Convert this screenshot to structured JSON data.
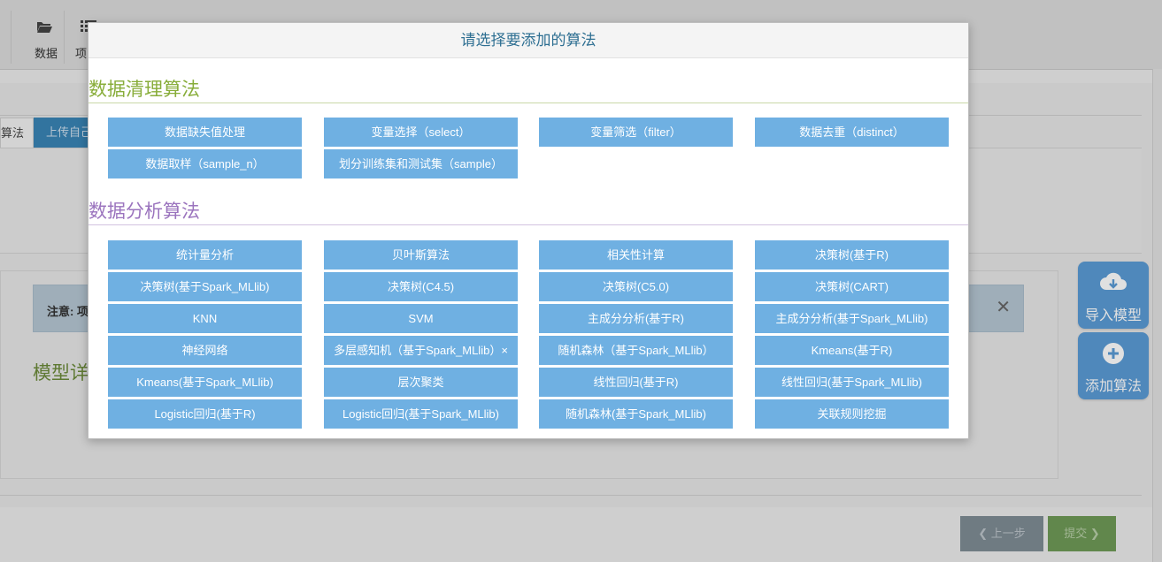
{
  "toolbar": {
    "items": [
      {
        "label": "数据",
        "icon": "folder-open-icon"
      },
      {
        "label": "项",
        "icon": "list-icon"
      }
    ]
  },
  "tabs": {
    "active_label": "算法",
    "upload_label": "上传自己"
  },
  "notice": {
    "text": "注意: 项",
    "close": "✕"
  },
  "section_heading": "模型详",
  "actions": {
    "prev_label": "上一步",
    "prev_icon": "❮",
    "next_label": "提交",
    "next_icon": "❯"
  },
  "side_buttons": {
    "import_label": "导入模型",
    "add_label": "添加算法"
  },
  "modal": {
    "title": "请选择要添加的算法",
    "cleaning": {
      "title": "数据清理算法",
      "items": [
        "数据缺失值处理",
        "变量选择（select）",
        "变量筛选（filter）",
        "数据去重（distinct）",
        "数据取样（sample_n）",
        "划分训练集和测试集（sample）"
      ]
    },
    "analysis": {
      "title": "数据分析算法",
      "items": [
        "统计量分析",
        "贝叶斯算法",
        "相关性计算",
        "决策树(基于R)",
        "决策树(基于Spark_MLlib)",
        "决策树(C4.5)",
        "决策树(C5.0)",
        "决策树(CART)",
        "KNN",
        "SVM",
        "主成分分析(基于R)",
        "主成分分析(基于Spark_MLlib)",
        "神经网络",
        "多层感知机（基于Spark_MLlib）×",
        "随机森林（基于Spark_MLlib）",
        "Kmeans(基于R)",
        "Kmeans(基于Spark_MLlib)",
        "层次聚类",
        "线性回归(基于R)",
        "线性回归(基于Spark_MLlib)",
        "Logistic回归(基于R)",
        "Logistic回归(基于Spark_MLlib)",
        "随机森林(基于Spark_MLlib)",
        "关联规则挖掘"
      ]
    }
  },
  "colors": {
    "algorithm_button": "#6fb0e2",
    "cleaning_title": "#88ad3a",
    "analysis_title": "#9b74be",
    "modal_title": "#2e6f92"
  }
}
